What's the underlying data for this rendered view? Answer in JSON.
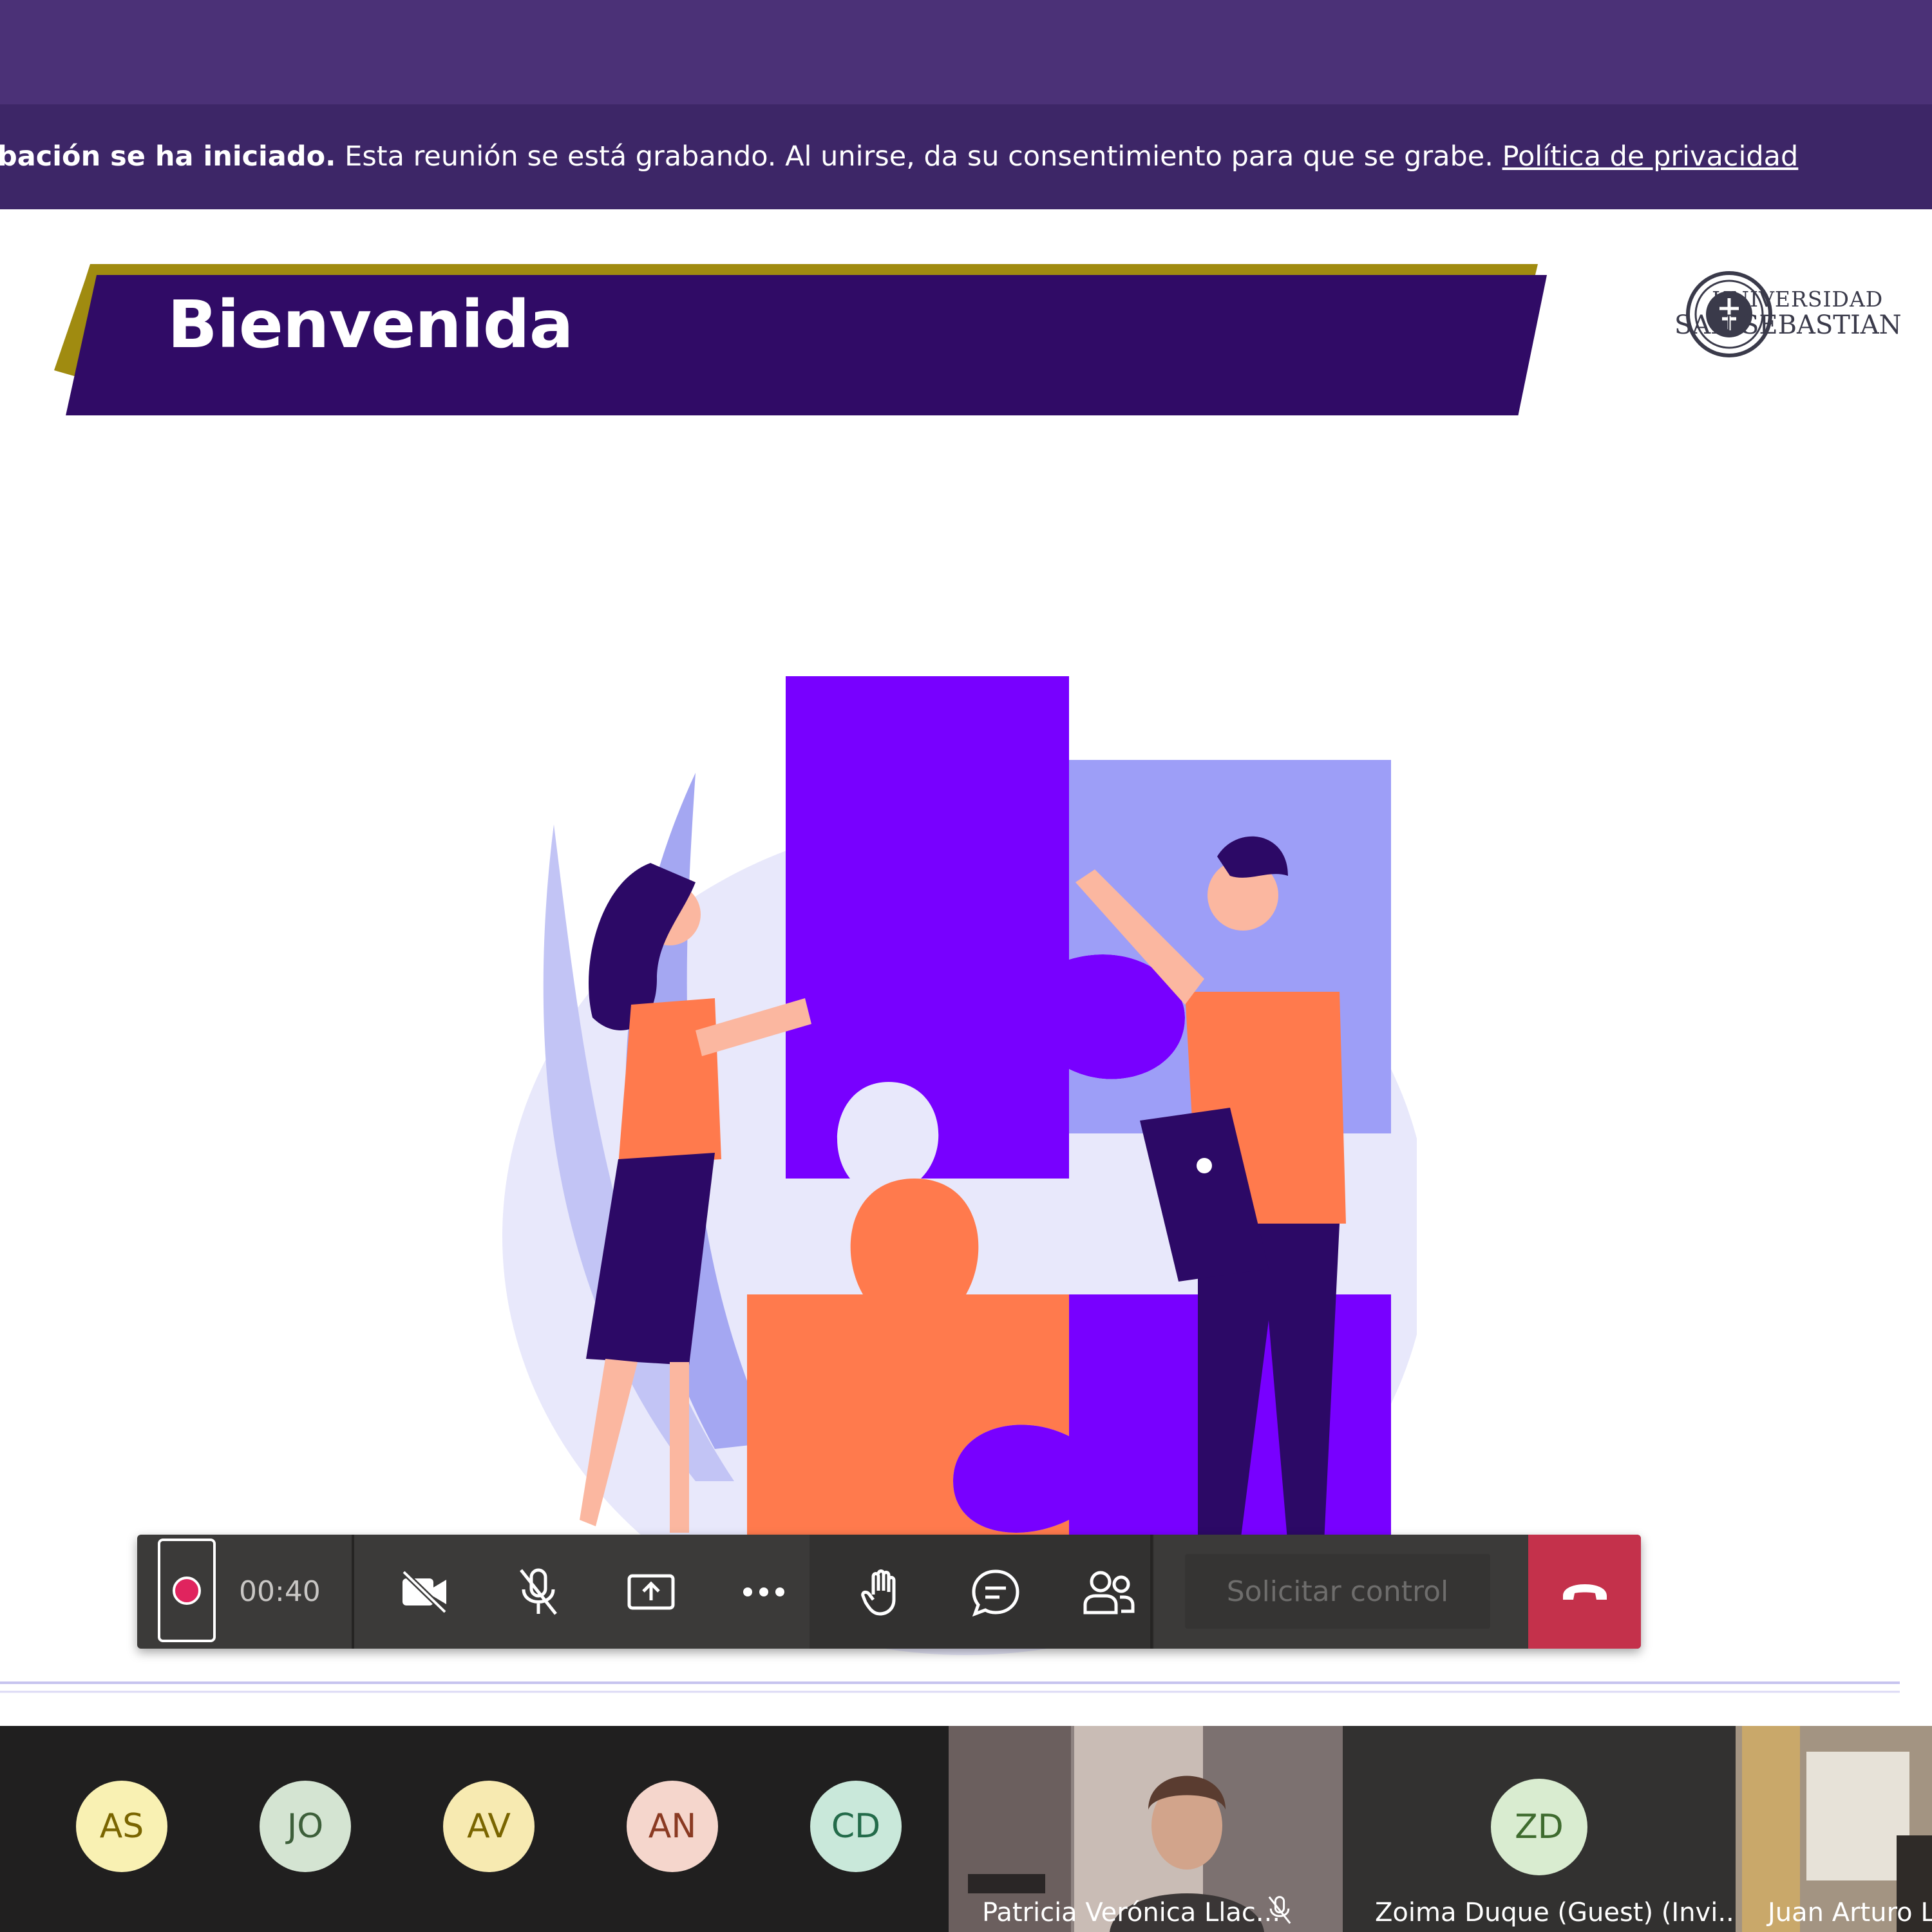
{
  "banner": {
    "bold": "bación se ha iniciado.",
    "text": " Esta reunión se está grabando. Al unirse, da su consentimiento para que se grabe. ",
    "link": "Política de privacidad"
  },
  "slide": {
    "title": "Bienvenida",
    "logo_line1": "UNIVERSIDAD",
    "logo_line2": "SAN SEBASTIAN"
  },
  "controls": {
    "timer": "00:40",
    "request_control": "Solicitar control",
    "icons": [
      "record-icon",
      "camera-off-icon",
      "mic-off-icon",
      "share-screen-icon",
      "more-icon",
      "raise-hand-icon",
      "chat-icon",
      "participants-icon",
      "hangup-icon"
    ]
  },
  "participants": {
    "avatars": [
      {
        "initials": "AS",
        "bg": "#f9f1b3",
        "fg": "#7a6500"
      },
      {
        "initials": "JO",
        "bg": "#d4e4d2",
        "fg": "#3d5f3a"
      },
      {
        "initials": "AV",
        "bg": "#f7eab1",
        "fg": "#7a6500"
      },
      {
        "initials": "AN",
        "bg": "#f5d6cc",
        "fg": "#8a3a22"
      },
      {
        "initials": "CD",
        "bg": "#c9e8da",
        "fg": "#236b4a"
      }
    ],
    "tiles": [
      {
        "name": "Patricia Verónica Llac..."
      },
      {
        "name": "Zoima Duque (Guest) (Invi...",
        "initials": "ZD",
        "bg": "#d9ecd0",
        "fg": "#3e6b2e"
      },
      {
        "name": "Juan Arturo Lo"
      }
    ]
  },
  "colors": {
    "topbar": "#4b3177",
    "banner": "#3d2667",
    "title_band": "#300b66",
    "title_stripe": "#a08b10",
    "hangup": "#c4314b"
  }
}
